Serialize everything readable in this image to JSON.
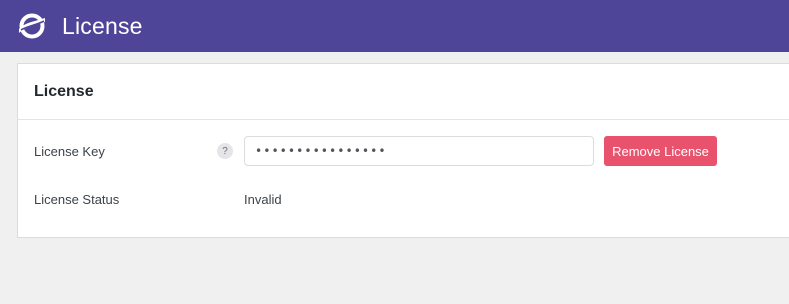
{
  "header": {
    "logo_icon": "brand-logo-icon",
    "title": "License",
    "background": "#4f4598"
  },
  "card": {
    "title": "License",
    "license_key": {
      "label": "License Key",
      "help": "?",
      "value": "••••••••••••••••",
      "button": "Remove License",
      "button_color": "#e8526c"
    },
    "license_status": {
      "label": "License Status",
      "value": "Invalid"
    }
  }
}
